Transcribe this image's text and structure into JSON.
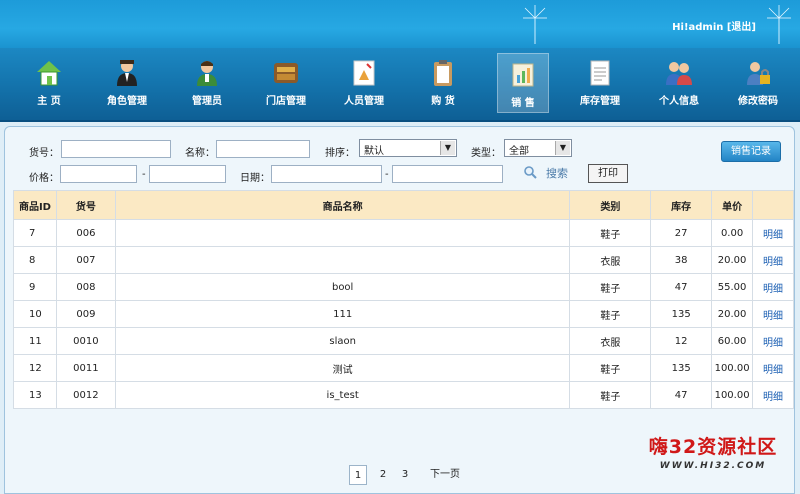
{
  "header": {
    "greeting": "Hi!admin",
    "logout": "[退出]"
  },
  "nav": [
    {
      "label": "主 页",
      "icon": "home-icon"
    },
    {
      "label": "角色管理",
      "icon": "waiter-icon"
    },
    {
      "label": "管理员",
      "icon": "admin-user-icon"
    },
    {
      "label": "门店管理",
      "icon": "store-icon"
    },
    {
      "label": "人员管理",
      "icon": "staff-document-icon"
    },
    {
      "label": "购 货",
      "icon": "clipboard-icon"
    },
    {
      "label": "销 售",
      "icon": "sales-chart-icon",
      "active": true
    },
    {
      "label": "库存管理",
      "icon": "inventory-document-icon"
    },
    {
      "label": "个人信息",
      "icon": "people-icon"
    },
    {
      "label": "修改密码",
      "icon": "lock-user-icon"
    }
  ],
  "filters": {
    "item_no_label": "货号：",
    "name_label": "名称：",
    "sort_label": "排序：",
    "sort_value": "默认",
    "type_label": "类型：",
    "type_value": "全部",
    "price_label": "价格：",
    "date_label": "日期：",
    "dash": "-",
    "search": "搜索",
    "print": "打印",
    "sales_record": "销售记录"
  },
  "table": {
    "headers": [
      "商品ID",
      "货号",
      "商品名称",
      "类别",
      "库存",
      "单价",
      ""
    ],
    "rows": [
      [
        "7",
        "006",
        "",
        "鞋子",
        "27",
        "0.00",
        "明细"
      ],
      [
        "8",
        "007",
        "",
        "衣服",
        "38",
        "20.00",
        "明细"
      ],
      [
        "9",
        "008",
        "bool",
        "鞋子",
        "47",
        "55.00",
        "明细"
      ],
      [
        "10",
        "009",
        "111",
        "鞋子",
        "135",
        "20.00",
        "明细"
      ],
      [
        "11",
        "0010",
        "slaon",
        "衣服",
        "12",
        "60.00",
        "明细"
      ],
      [
        "12",
        "0011",
        "测试",
        "鞋子",
        "135",
        "100.00",
        "明细"
      ],
      [
        "13",
        "0012",
        "is_test",
        "鞋子",
        "47",
        "100.00",
        "明细"
      ]
    ]
  },
  "pager": {
    "pages": [
      "1",
      "2",
      "3"
    ],
    "next": "下一页",
    "current": "1"
  },
  "watermark": {
    "line1": "嗨32资源社区",
    "line2": "WWW.HI32.COM"
  },
  "colors": {
    "accent": "#1b93d0",
    "header_row": "#fbe9c4",
    "link": "#1b5fb3"
  }
}
